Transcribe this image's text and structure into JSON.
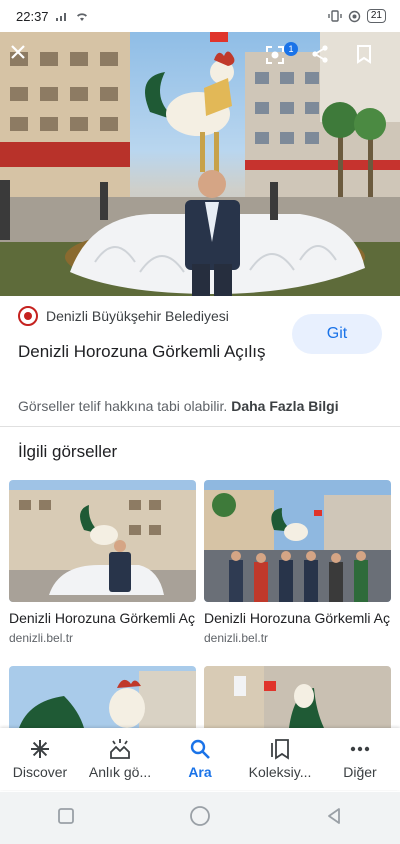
{
  "status_bar": {
    "time": "22:37",
    "battery": "21"
  },
  "hero": {
    "lens_badge_count": "1"
  },
  "result": {
    "source_name": "Denizli Büyükşehir Belediyesi",
    "visit_label": "Git",
    "title": "Denizli Horozuna Görkemli Açılış",
    "copyright_text": "Görseller telif hakkına tabi olabilir.",
    "more_info_label": "Daha Fazla Bilgi"
  },
  "related": {
    "heading": "İlgili görseller",
    "cards": [
      {
        "title": "Denizli Horozuna Görkemli Açılış",
        "domain": "denizli.bel.tr"
      },
      {
        "title": "Denizli Horozuna Görkemli Açılış",
        "domain": "denizli.bel.tr"
      }
    ]
  },
  "bottom_nav": {
    "items": [
      {
        "label": "Discover",
        "icon": "asterisk-icon"
      },
      {
        "label": "Anlık gö...",
        "icon": "updates-icon"
      },
      {
        "label": "Ara",
        "icon": "search-icon"
      },
      {
        "label": "Koleksiy...",
        "icon": "collections-icon"
      },
      {
        "label": "Diğer",
        "icon": "more-dots-icon"
      }
    ],
    "active_color": "#1a73e8"
  }
}
